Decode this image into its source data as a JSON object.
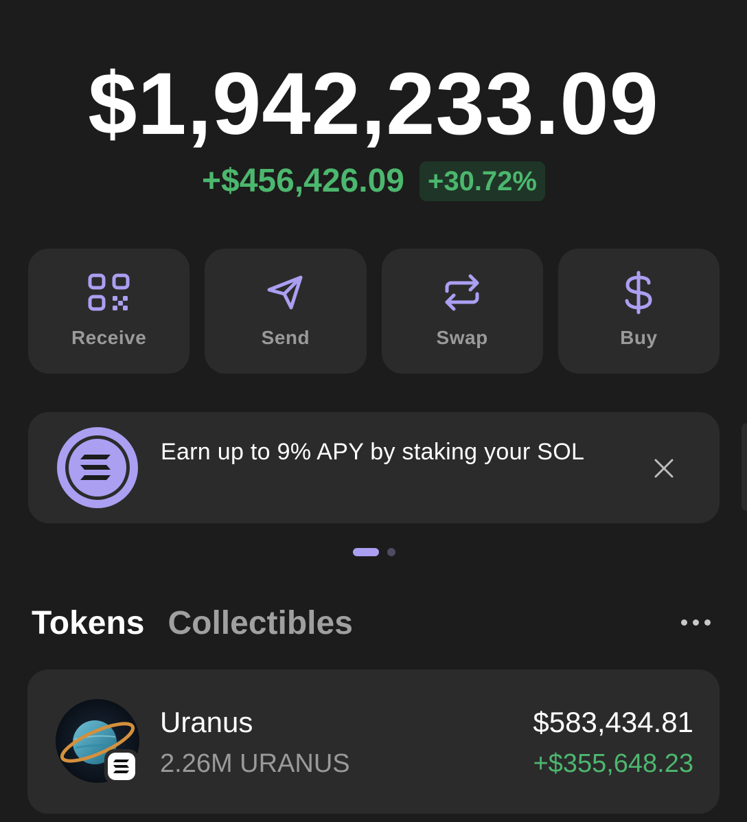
{
  "balance": {
    "total": "$1,942,233.09",
    "change_amount": "+$456,426.09",
    "change_percent": "+30.72%"
  },
  "actions": [
    {
      "label": "Receive",
      "icon": "qr-code-icon"
    },
    {
      "label": "Send",
      "icon": "send-icon"
    },
    {
      "label": "Swap",
      "icon": "swap-icon"
    },
    {
      "label": "Buy",
      "icon": "dollar-icon"
    }
  ],
  "promo": {
    "text": "Earn up to 9% APY by staking your SOL",
    "icon": "solana-logo-icon",
    "close_icon": "close-icon"
  },
  "carousel": {
    "active_index": 0,
    "count": 2
  },
  "tabs": [
    {
      "label": "Tokens",
      "active": true
    },
    {
      "label": "Collectibles",
      "active": false
    }
  ],
  "tokens": [
    {
      "name": "Uranus",
      "amount": "2.26M URANUS",
      "value": "$583,434.81",
      "change": "+$355,648.23",
      "icon": "uranus-token-icon",
      "chain_badge": "solana-badge-icon"
    }
  ],
  "colors": {
    "background": "#1c1c1c",
    "card": "#2b2b2b",
    "accent": "#ab9ff2",
    "positive": "#4cb76e"
  }
}
